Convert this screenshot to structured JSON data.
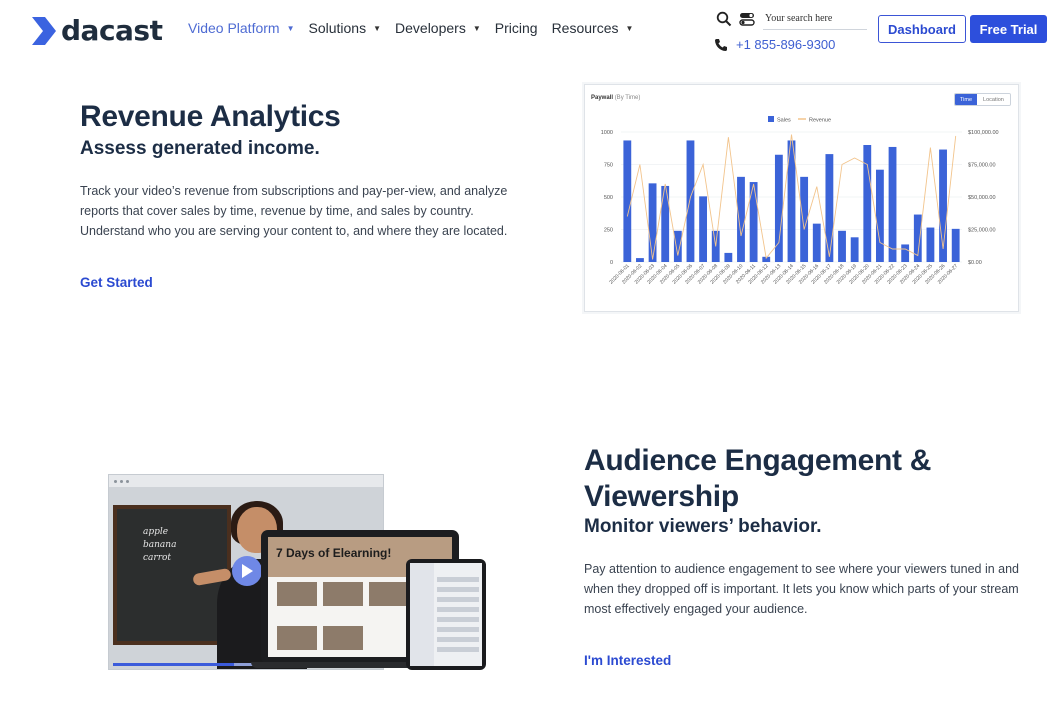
{
  "header": {
    "logo_text": "dacast",
    "nav": [
      {
        "label": "Video Platform",
        "active": true,
        "has_dropdown": true
      },
      {
        "label": "Solutions",
        "active": false,
        "has_dropdown": true
      },
      {
        "label": "Developers",
        "active": false,
        "has_dropdown": true
      },
      {
        "label": "Pricing",
        "active": false,
        "has_dropdown": false
      },
      {
        "label": "Resources",
        "active": false,
        "has_dropdown": true
      }
    ],
    "search_placeholder": "Your search here",
    "phone": "+1 855-896-9300",
    "dashboard_label": "Dashboard",
    "trial_label": "Free Trial"
  },
  "revenue": {
    "title": "Revenue Analytics",
    "subtitle": "Assess generated income.",
    "body": "Track your video’s revenue from subscriptions and pay-per-view, and analyze reports that cover sales by time, revenue by time, and sales by country. Understand who you are serving your content to, and where they are located.",
    "cta": "Get Started"
  },
  "engagement": {
    "title": "Audience Engagement & Viewership",
    "subtitle": "Monitor viewers’ behavior.",
    "body": "Pay attention to audience engagement to see where your viewers tuned in and when they dropped off is important. It lets you know which parts of your stream most effectively engaged your audience.",
    "cta": "I'm Interested"
  },
  "illustration": {
    "laptop_title": "7 Days of Elearning!",
    "chalk_words": [
      "apple",
      "banana",
      "carrot"
    ],
    "progress_fraction": 0.45
  },
  "chart_data": {
    "type": "bar",
    "title": "Paywall",
    "title_suffix": "(By Time)",
    "toggle": [
      "Time",
      "Location"
    ],
    "toggle_active": "Time",
    "legend": [
      "Sales",
      "Revenue"
    ],
    "legend_position": "top-center",
    "categories": [
      "2020-06-01",
      "2020-06-02",
      "2020-06-03",
      "2020-06-04",
      "2020-06-05",
      "2020-06-06",
      "2020-06-07",
      "2020-06-08",
      "2020-06-09",
      "2020-06-10",
      "2020-06-11",
      "2020-06-12",
      "2020-06-13",
      "2020-06-14",
      "2020-06-15",
      "2020-06-16",
      "2020-06-17",
      "2020-06-18",
      "2020-06-19",
      "2020-06-20",
      "2020-06-21",
      "2020-06-22",
      "2020-06-23",
      "2020-06-24",
      "2020-06-25",
      "2020-06-26",
      "2020-06-27"
    ],
    "series": [
      {
        "name": "Sales",
        "type": "bar",
        "axis": "left",
        "color": "#3b63d8",
        "values": [
          935,
          30,
          605,
          585,
          240,
          935,
          505,
          240,
          70,
          655,
          615,
          40,
          825,
          935,
          655,
          295,
          830,
          240,
          190,
          900,
          710,
          885,
          135,
          365,
          265,
          865,
          255
        ]
      },
      {
        "name": "Revenue",
        "type": "line",
        "axis": "right",
        "color": "#f2c48c",
        "values": [
          35000,
          75000,
          2000,
          60000,
          5000,
          50000,
          75000,
          12000,
          96000,
          20000,
          60000,
          3000,
          15000,
          98000,
          25000,
          58000,
          4000,
          75000,
          80000,
          75000,
          15000,
          10000,
          10000,
          5000,
          88000,
          10000,
          97000
        ]
      }
    ],
    "y_left_ticks": [
      "1000",
      "750",
      "500",
      "250",
      "0"
    ],
    "y_right_ticks": [
      "$100,000.00",
      "$75,000.00",
      "$50,000.00",
      "$25,000.00",
      "$0.00"
    ],
    "ylim_left": [
      0,
      1000
    ],
    "ylim_right": [
      0,
      100000
    ],
    "grid": true
  }
}
